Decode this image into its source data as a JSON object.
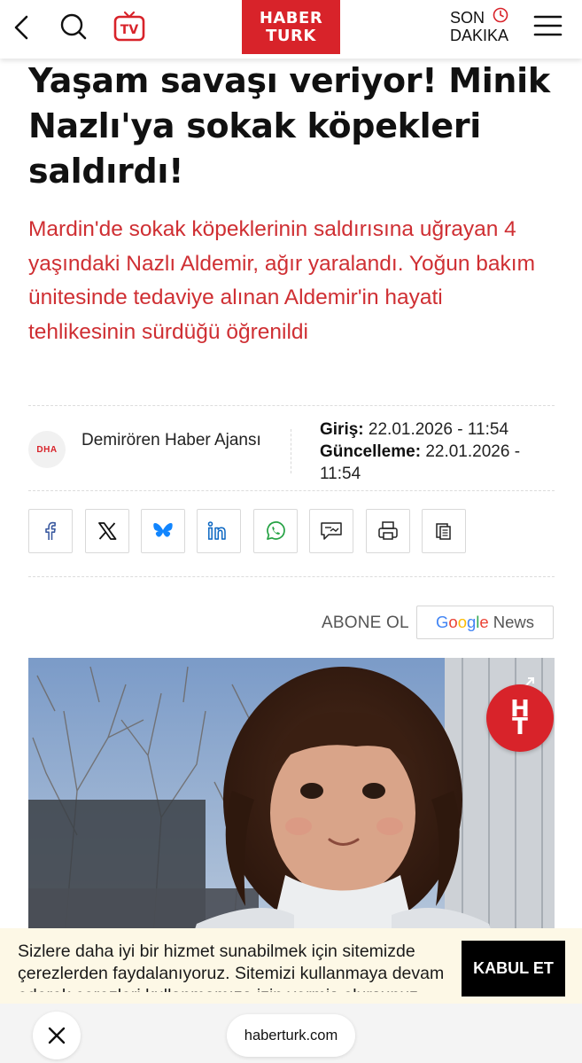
{
  "header": {
    "logo_line1": "HABER",
    "logo_line2": "TURK",
    "tv_label": "TV",
    "son_dakika_line1": "SON",
    "son_dakika_line2": "DAKIKA",
    "icons": [
      "back-icon",
      "search-icon",
      "tv-icon",
      "clock-icon",
      "menu-icon"
    ],
    "brand_color": "#d8232a"
  },
  "article": {
    "headline": "Yaşam savaşı veriyor! Minik Nazlı'ya sokak köpekleri saldırdı!",
    "summary": "Mardin'de sokak köpeklerinin saldırısına uğrayan 4 yaşındaki Nazlı Aldemir, ağır yaralandı. Yoğun bakım ünitesinde tedaviye alınan Aldemir'in hayati tehlikesinin sürdüğü öğrenildi",
    "summary_color": "#cf2f33",
    "source": {
      "logo_text": "DHA",
      "name": "Demirören Haber Ajansı"
    },
    "dates": {
      "giris_label": "Giriş:",
      "giris_value": "22.01.2026 - 11:54",
      "guncelleme_label": "Güncelleme:",
      "guncelleme_value": "22.01.2026 - 11:54"
    }
  },
  "share": {
    "buttons": [
      "facebook-icon",
      "x-icon",
      "bluesky-icon",
      "linkedin-icon",
      "whatsapp-icon",
      "comment-icon",
      "print-icon",
      "copy-icon"
    ]
  },
  "subscribe": {
    "label": "ABONE OL",
    "google": [
      "G",
      "o",
      "o",
      "g",
      "l",
      "e"
    ],
    "news": "News"
  },
  "photo": {
    "badge_line1": "H",
    "badge_line2": "T"
  },
  "cookie": {
    "text": "Sizlere daha iyi bir hizmet sunabilmek için sitemizde çerezlerden faydalanıyoruz. Sitemizi kullanmaya devam ederek çerezleri kullanmamıza izin vermiş olursunuz.",
    "button": "KABUL ET"
  },
  "browser": {
    "url": "haberturk.com",
    "close_icon": "close-icon"
  }
}
